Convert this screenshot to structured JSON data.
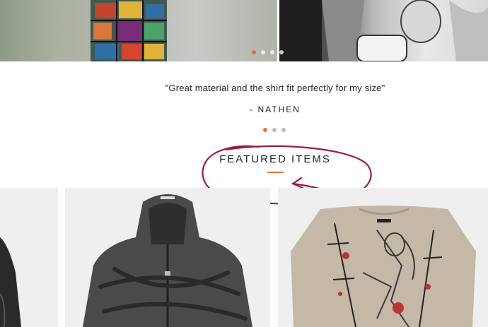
{
  "hero": {
    "slides": 4,
    "active_slide": 0
  },
  "testimonial": {
    "quote": "\"Great material and the shirt fit perfectly for my size\"",
    "author": "- NATHEN",
    "dots": 3,
    "active_dot": 0
  },
  "featured": {
    "title": "FEATURED ITEMS"
  },
  "colors": {
    "accent": "#e8703a",
    "annotation": "#9b1b4a",
    "card_bg": "#efefef"
  },
  "products": [
    {
      "name_icon": "dark-garment-partial"
    },
    {
      "name_icon": "grey-zip-hoodie"
    },
    {
      "name_icon": "beige-graphic-sweater"
    }
  ]
}
